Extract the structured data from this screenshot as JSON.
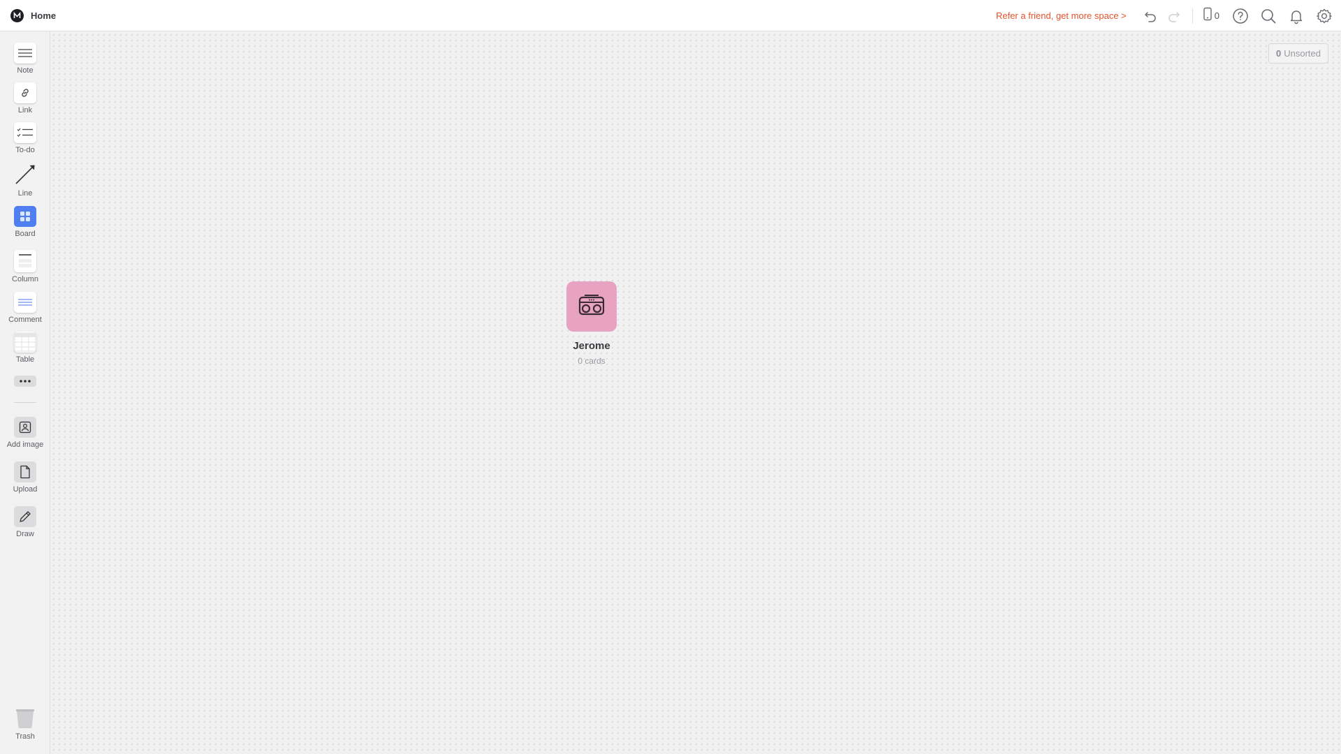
{
  "header": {
    "home_label": "Home",
    "refer_text": "Refer a friend, get more space >",
    "device_count": "0",
    "icons": [
      "undo-icon",
      "redo-icon",
      "device-icon",
      "help-icon",
      "search-icon",
      "bell-icon",
      "gear-icon"
    ]
  },
  "sidebar": {
    "tools": [
      {
        "label": "Note",
        "icon": "note-icon"
      },
      {
        "label": "Link",
        "icon": "link-icon"
      },
      {
        "label": "To-do",
        "icon": "todo-icon"
      },
      {
        "label": "Line",
        "icon": "line-icon"
      },
      {
        "label": "Board",
        "icon": "board-icon"
      },
      {
        "label": "Column",
        "icon": "column-icon"
      },
      {
        "label": "Comment",
        "icon": "comment-icon"
      },
      {
        "label": "Table",
        "icon": "table-icon"
      },
      {
        "label": "",
        "icon": "more-icon"
      },
      {
        "label": "Add image",
        "icon": "image-icon"
      },
      {
        "label": "Upload",
        "icon": "upload-icon"
      },
      {
        "label": "Draw",
        "icon": "pencil-icon"
      },
      {
        "label": "Trash",
        "icon": "trash-icon"
      }
    ]
  },
  "canvas": {
    "unsorted_count": "0",
    "unsorted_label": "Unsorted",
    "board": {
      "name": "Jerome",
      "count_text": "0 cards",
      "icon": "boombox-icon",
      "tile_color": "#e8a3c3"
    }
  },
  "colors": {
    "accent": "#4f7ff0",
    "refer": "#e4532b"
  }
}
